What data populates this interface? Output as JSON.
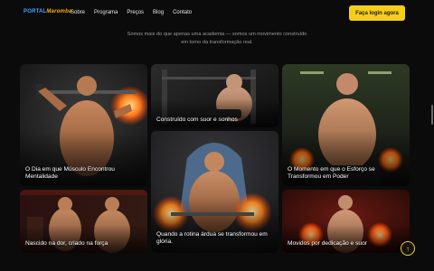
{
  "nav": {
    "logo_part1": "PORTAL",
    "logo_part2": "Maromba",
    "links": [
      "Sobre",
      "Programa",
      "Preços",
      "Blog",
      "Contato"
    ],
    "cta_label": "Faça login agora"
  },
  "intro": {
    "text": "Somos mais do que apenas uma academia — somos um movimento construído em torno da transformação real."
  },
  "gallery": [
    {
      "caption": "O Dia em que Músculo Encontrou Mentalidade"
    },
    {
      "caption": "Construído com suor e sonhos"
    },
    {
      "caption": "O Momento em que o Esforço se Transformou em Poder"
    },
    {
      "caption": "Quando a rotina árdua se transformou em glória."
    },
    {
      "caption": "Nascido na dor, criado na força"
    },
    {
      "caption": "Movidos por dedicação e suor"
    }
  ],
  "colors": {
    "accent": "#f5cf16",
    "background": "#0b0b0b",
    "logo_blue": "#4aa3ff",
    "logo_orange": "#ffb400"
  },
  "icons": {
    "back_to_top": "arrow-up-icon"
  }
}
